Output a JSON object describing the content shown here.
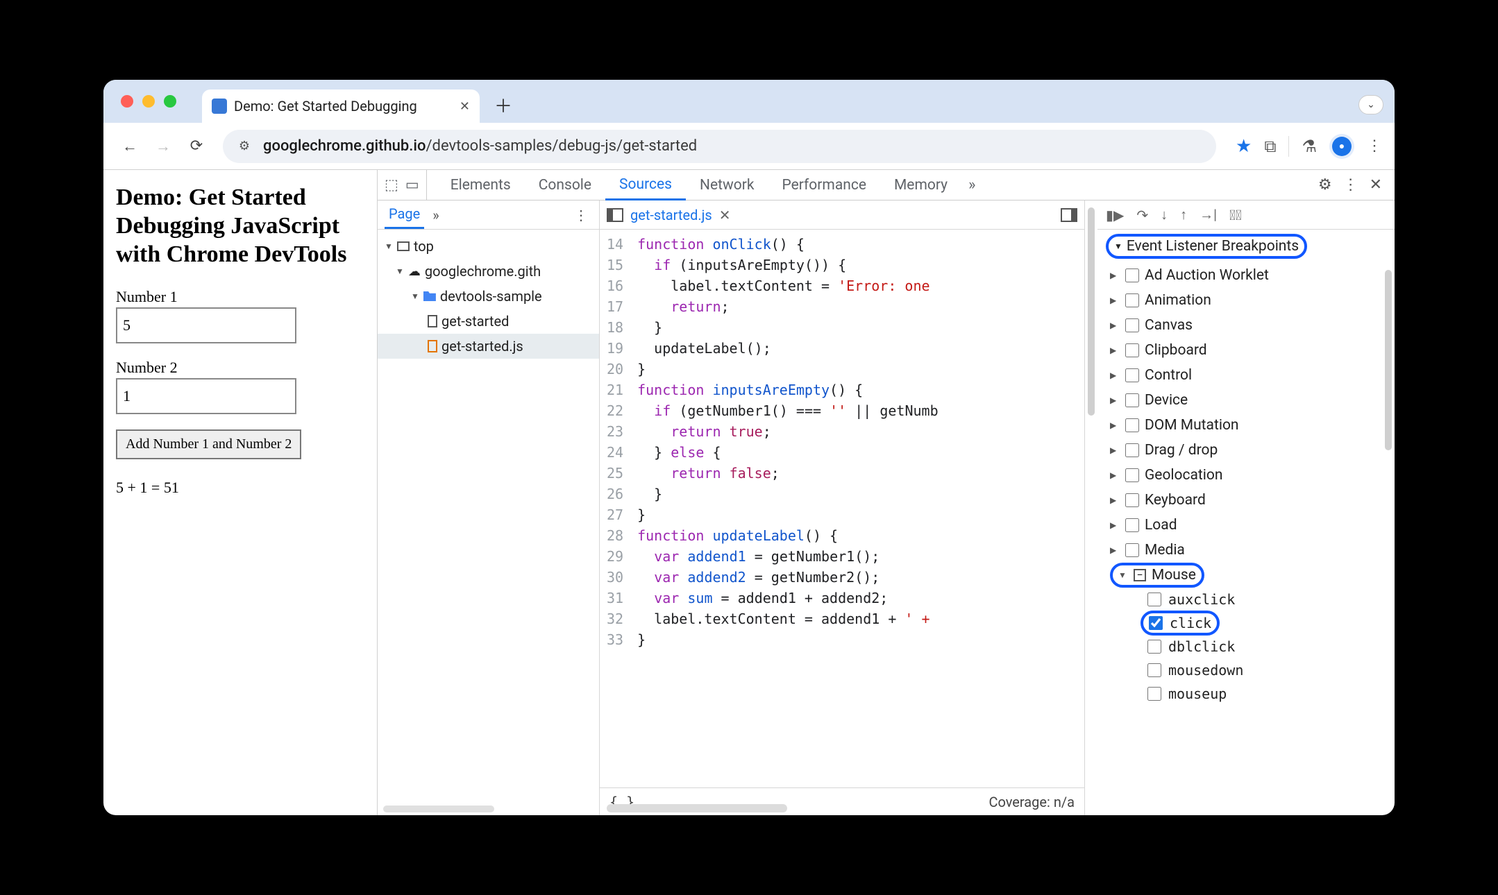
{
  "chrome": {
    "tab_title": "Demo: Get Started Debugging",
    "omnibox_host": "googlechrome.github.io",
    "omnibox_path": "/devtools-samples/debug-js/get-started"
  },
  "page": {
    "heading": "Demo: Get Started Debugging JavaScript with Chrome DevTools",
    "label_n1": "Number 1",
    "value_n1": "5",
    "label_n2": "Number 2",
    "value_n2": "1",
    "add_button": "Add Number 1 and Number 2",
    "result": "5 + 1 = 51"
  },
  "devtools": {
    "panels": [
      "Elements",
      "Console",
      "Sources",
      "Network",
      "Performance",
      "Memory"
    ],
    "active_panel": "Sources",
    "navigator": {
      "subtab": "Page",
      "tree": {
        "top": "top",
        "origin": "googlechrome.gith",
        "folder": "devtools-sample",
        "files": [
          "get-started",
          "get-started.js"
        ],
        "selected": "get-started.js"
      }
    },
    "editor": {
      "open_file": "get-started.js",
      "first_line": 14,
      "lines": [
        {
          "n": 14,
          "t": "function onClick() {"
        },
        {
          "n": 15,
          "t": "  if (inputsAreEmpty()) {"
        },
        {
          "n": 16,
          "t": "    label.textContent = 'Error: one"
        },
        {
          "n": 17,
          "t": "    return;"
        },
        {
          "n": 18,
          "t": "  }"
        },
        {
          "n": 19,
          "t": "  updateLabel();"
        },
        {
          "n": 20,
          "t": "}"
        },
        {
          "n": 21,
          "t": "function inputsAreEmpty() {"
        },
        {
          "n": 22,
          "t": "  if (getNumber1() === '' || getNumb"
        },
        {
          "n": 23,
          "t": "    return true;"
        },
        {
          "n": 24,
          "t": "  } else {"
        },
        {
          "n": 25,
          "t": "    return false;"
        },
        {
          "n": 26,
          "t": "  }"
        },
        {
          "n": 27,
          "t": "}"
        },
        {
          "n": 28,
          "t": "function updateLabel() {"
        },
        {
          "n": 29,
          "t": "  var addend1 = getNumber1();"
        },
        {
          "n": 30,
          "t": "  var addend2 = getNumber2();"
        },
        {
          "n": 31,
          "t": "  var sum = addend1 + addend2;"
        },
        {
          "n": 32,
          "t": "  label.textContent = addend1 + ' +"
        },
        {
          "n": 33,
          "t": "}"
        }
      ],
      "coverage": "Coverage: n/a"
    },
    "breakpoints": {
      "section_title": "Event Listener Breakpoints",
      "categories": [
        {
          "name": "Ad Auction Worklet",
          "expanded": false,
          "checked": false
        },
        {
          "name": "Animation",
          "expanded": false,
          "checked": false
        },
        {
          "name": "Canvas",
          "expanded": false,
          "checked": false
        },
        {
          "name": "Clipboard",
          "expanded": false,
          "checked": false
        },
        {
          "name": "Control",
          "expanded": false,
          "checked": false
        },
        {
          "name": "Device",
          "expanded": false,
          "checked": false
        },
        {
          "name": "DOM Mutation",
          "expanded": false,
          "checked": false
        },
        {
          "name": "Drag / drop",
          "expanded": false,
          "checked": false
        },
        {
          "name": "Geolocation",
          "expanded": false,
          "checked": false
        },
        {
          "name": "Keyboard",
          "expanded": false,
          "checked": false
        },
        {
          "name": "Load",
          "expanded": false,
          "checked": false
        },
        {
          "name": "Media",
          "expanded": false,
          "checked": false
        },
        {
          "name": "Mouse",
          "expanded": true,
          "checked": "mixed",
          "events": [
            {
              "name": "auxclick",
              "checked": false
            },
            {
              "name": "click",
              "checked": true
            },
            {
              "name": "dblclick",
              "checked": false
            },
            {
              "name": "mousedown",
              "checked": false
            },
            {
              "name": "mouseup",
              "checked": false
            }
          ]
        }
      ]
    }
  }
}
